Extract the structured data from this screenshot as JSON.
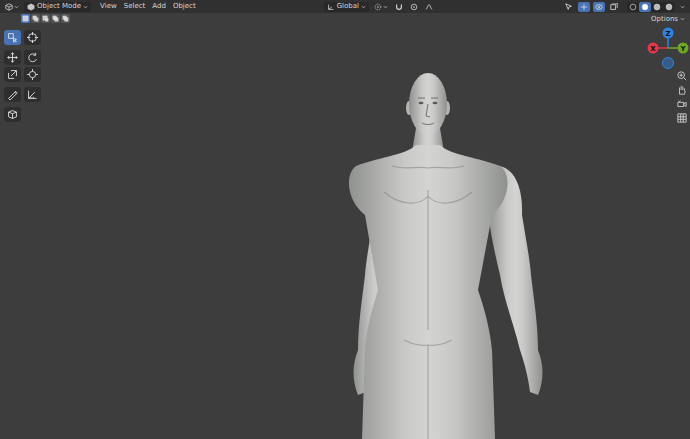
{
  "header": {
    "mode": "Object Mode",
    "menus": [
      "View",
      "Select",
      "Add",
      "Object"
    ],
    "orientation": "Global",
    "toggles": [
      {
        "selected": false
      },
      {
        "selected": true
      },
      {
        "selected": true
      },
      {
        "selected": false
      }
    ]
  },
  "select_modes": [
    {
      "selected": true
    },
    {
      "selected": false
    },
    {
      "selected": false
    },
    {
      "selected": false
    },
    {
      "selected": false
    }
  ],
  "tools": [
    {
      "selected": true
    },
    {
      "selected": false
    },
    {
      "selected": false
    },
    {
      "selected": false
    },
    {
      "selected": false
    },
    {
      "selected": false
    },
    {
      "selected": false
    },
    {
      "selected": false
    },
    {
      "selected": false
    }
  ],
  "options": "Options",
  "gizmo": {
    "axes": [
      {
        "label": "Z",
        "color": "#2f83e0",
        "negative_shown": true
      },
      {
        "label": "X",
        "color": "#e1394b",
        "negative_shown": false
      },
      {
        "label": "Y",
        "color": "#6ea628",
        "negative_shown": false
      }
    ]
  },
  "shading_modes": [
    {
      "selected": false
    },
    {
      "selected": true
    },
    {
      "selected": false
    },
    {
      "selected": false
    }
  ]
}
